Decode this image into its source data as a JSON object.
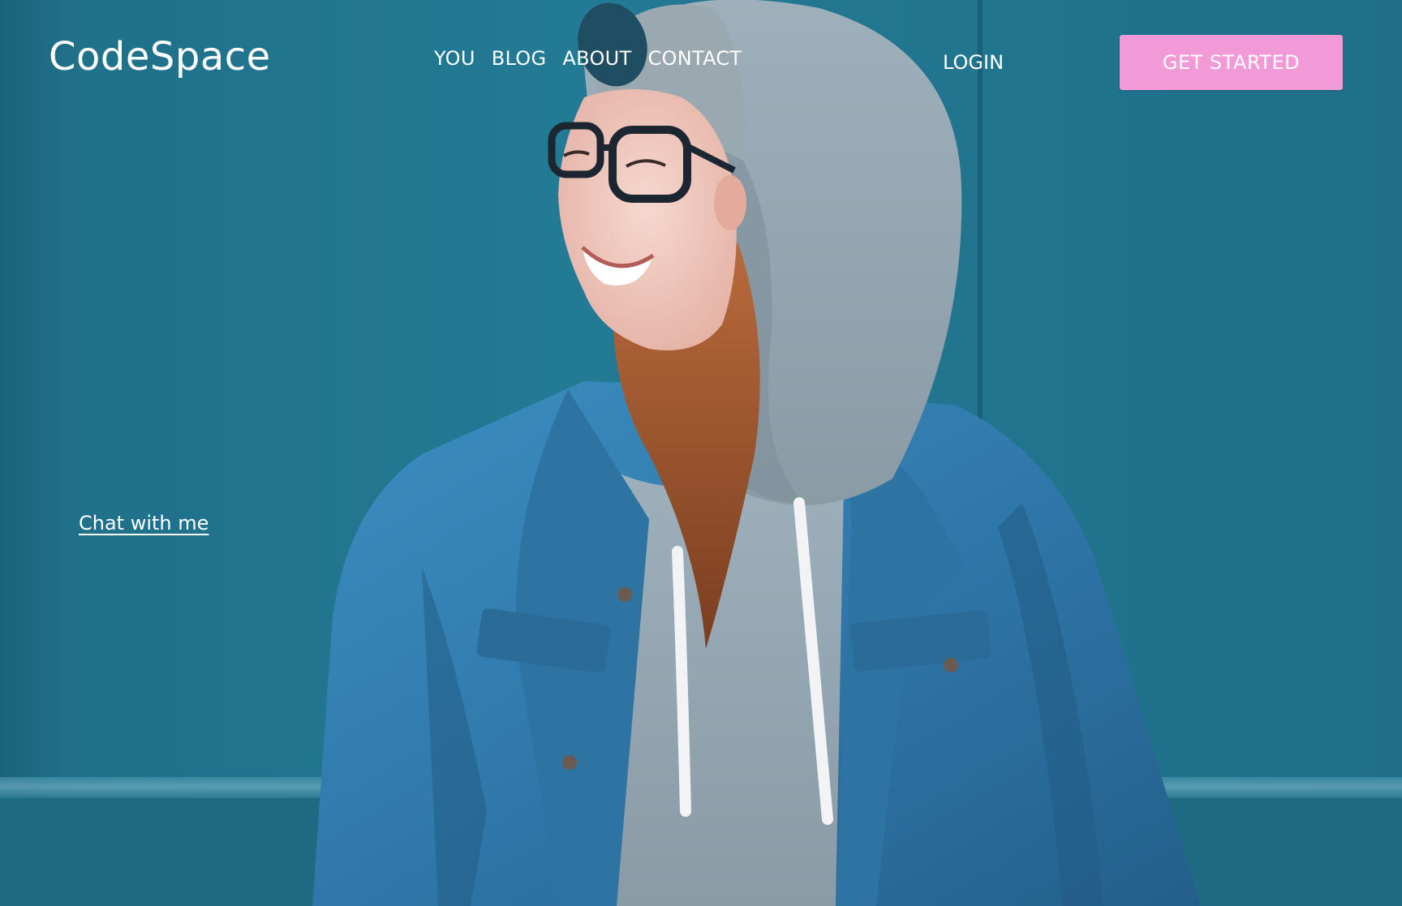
{
  "brand": {
    "logo_text": "CodeSpace"
  },
  "nav": {
    "links": [
      {
        "label": "YOU"
      },
      {
        "label": "BLOG"
      },
      {
        "label": "ABOUT"
      },
      {
        "label": "CONTACT"
      }
    ],
    "login_label": "LOGIN",
    "cta_label": "GET STARTED"
  },
  "hero": {
    "chat_link": "Chat with me"
  },
  "colors": {
    "background": "#1f6f88",
    "cta": "#f29ad8",
    "text": "#ffffff"
  }
}
